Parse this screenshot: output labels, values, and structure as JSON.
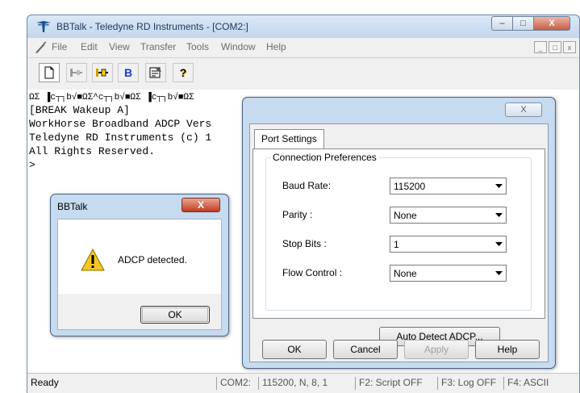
{
  "app": {
    "title": "BBTalk - Teledyne RD Instruments - [COM2:]",
    "icon": "teledyne-logo-icon",
    "window_buttons": {
      "minimize": "–",
      "maximize": "□",
      "close": "X"
    }
  },
  "menu": {
    "items": [
      "File",
      "Edit",
      "View",
      "Transfer",
      "Tools",
      "Window",
      "Help"
    ],
    "mdi_buttons": [
      "_",
      "□",
      "x"
    ]
  },
  "toolbar": {
    "buttons": [
      {
        "name": "new-document-icon"
      },
      {
        "name": "disconnect-icon"
      },
      {
        "name": "connect-icon"
      },
      {
        "name": "break-icon",
        "label": "B"
      },
      {
        "name": "properties-icon"
      },
      {
        "name": "help-icon",
        "label": "?"
      }
    ]
  },
  "terminal": {
    "lines": [
      "ΩΣ ▐c┬┐b√■ΩΣ^c┬┐b√■ΩΣ ▐c┬┐b√■ΩΣ",
      "[BREAK Wakeup A]",
      "WorkHorse Broadband ADCP Vers",
      "Teledyne RD Instruments (c) 1",
      "All Rights Reserved.",
      ">"
    ]
  },
  "status_bar": {
    "ready": "Ready",
    "port": "COM2:",
    "settings": "115200, N, 8, 1",
    "f2": "F2: Script OFF",
    "f3": "F3: Log OFF",
    "f4": "F4: ASCII"
  },
  "port_dialog": {
    "close": "X",
    "tab": "Port Settings",
    "group_title": "Connection Preferences",
    "fields": [
      {
        "label": "Baud Rate:",
        "value": "115200"
      },
      {
        "label": "Parity :",
        "value": "None"
      },
      {
        "label": "Stop Bits :",
        "value": "1"
      },
      {
        "label": "Flow Control :",
        "value": "None"
      }
    ],
    "auto_detect": "Auto Detect ADCP...",
    "buttons": {
      "ok": "OK",
      "cancel": "Cancel",
      "apply": "Apply",
      "help": "Help"
    }
  },
  "message_dialog": {
    "title": "BBTalk",
    "close": "X",
    "icon": "warning-icon",
    "message": "ADCP detected.",
    "ok": "OK"
  },
  "colors": {
    "window_frame": "#b9d1ea",
    "close_red": "#c85d45",
    "warning_yellow": "#f3c623"
  }
}
